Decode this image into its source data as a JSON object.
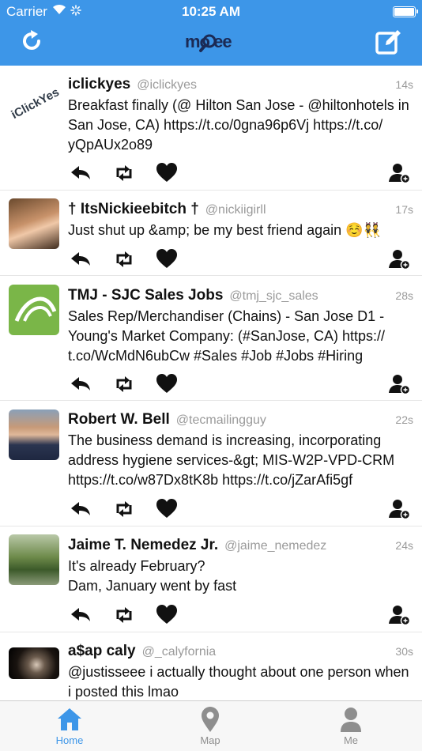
{
  "status_bar": {
    "carrier": "Carrier",
    "time": "10:25 AM"
  },
  "header": {
    "logo_text": "mo ee"
  },
  "tweets": [
    {
      "name": "iclickyes",
      "handle": "@iclickyes",
      "time": "14s",
      "text": "Breakfast finally (@ Hilton San Jose - @hiltonhotels in San Jose, CA) https://t.co/0gna96p6Vj https://t.co/\nyQpAUx2o89",
      "avatar_label": "iClickYes"
    },
    {
      "name": "† ItsNickieebitch †",
      "handle": "@nickiigirll",
      "time": "17s",
      "text": "Just shut up &amp; be my best friend again ☺️👯"
    },
    {
      "name": "TMJ - SJC Sales Jobs",
      "handle": "@tmj_sjc_sales",
      "time": "28s",
      "text": "Sales Rep/Merchandiser (Chains) - San Jose D1 -\nYoung's Market Company: (#SanJose, CA) https://\nt.co/WcMdN6ubCw #Sales #Job #Jobs #Hiring"
    },
    {
      "name": "Robert W. Bell",
      "handle": "@tecmailingguy",
      "time": "22s",
      "text": "The business demand is increasing, incorporating\naddress hygiene services-&gt; MIS-W2P-VPD-CRM\nhttps://t.co/w87Dx8tK8b https://t.co/jZarAfi5gf"
    },
    {
      "name": "Jaime T. Nemedez Jr.",
      "handle": "@jaime_nemedez",
      "time": "24s",
      "text": "It's already February?\nDam, January went by fast"
    },
    {
      "name": "a$ap caly",
      "handle": "@_calyfornia",
      "time": "30s",
      "text": "@justisseee i actually thought about one person when\ni posted this lmao"
    }
  ],
  "tabs": [
    {
      "label": "Home",
      "active": true
    },
    {
      "label": "Map",
      "active": false
    },
    {
      "label": "Me",
      "active": false
    }
  ],
  "colors": {
    "accent": "#3d96e8",
    "tab_inactive": "#8e8e8e"
  }
}
